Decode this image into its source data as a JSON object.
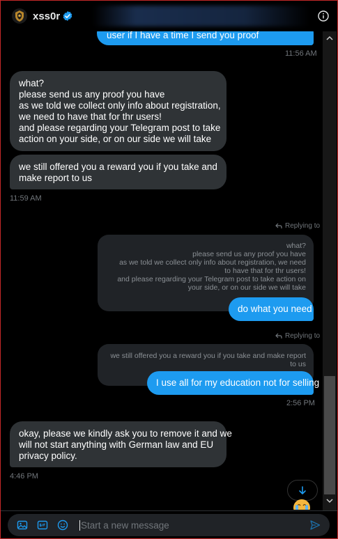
{
  "header": {
    "name": "xss0r",
    "verified_icon": "verified-badge-icon",
    "info_icon": "info-icon",
    "avatar_icon": "avatar-logo"
  },
  "messages": [
    {
      "from": "me",
      "lines": [
        "user if I have a time I send you proof"
      ],
      "time": "11:56 AM"
    },
    {
      "from": "them",
      "lines": [
        "what?",
        "please send us any proof you have",
        "as we told we collect only info about registration,",
        "we need to have that for thr users!",
        "and please regarding your Telegram post to take",
        "action on your side, or on our side we will take"
      ]
    },
    {
      "from": "them",
      "lines": [
        "we still offered you a reward you if you take and",
        "make report to us"
      ],
      "time": "11:59 AM"
    },
    {
      "from": "me",
      "reply_label": "Replying to",
      "quote_lines": [
        "what?",
        "please send us any proof you have",
        "as we told we collect only info about registration, we need",
        "to have that for thr users!",
        "and please regarding your Telegram post to take action on",
        "your side, or on our side we will take"
      ],
      "lines": [
        "do what you need"
      ]
    },
    {
      "from": "me",
      "reply_label": "Replying to",
      "quote_lines": [
        "we still offered you a reward you if you take and make report",
        "to us"
      ],
      "lines": [
        "I use all for my education not for selling"
      ],
      "time": "2:56 PM"
    },
    {
      "from": "them",
      "lines": [
        "okay, please we kindly ask you to remove it and we",
        "will not start anything with German law and EU",
        "privacy policy."
      ],
      "time": "4:46 PM"
    }
  ],
  "composer": {
    "placeholder": "Start a new message",
    "tools": [
      "image-icon",
      "gif-icon",
      "emoji-icon"
    ],
    "send_icon": "send-icon"
  },
  "jump_icon": "arrow-down-icon",
  "colors": {
    "accent": "#1d9bf0",
    "received_bubble": "#2f3336",
    "background": "#000000"
  }
}
